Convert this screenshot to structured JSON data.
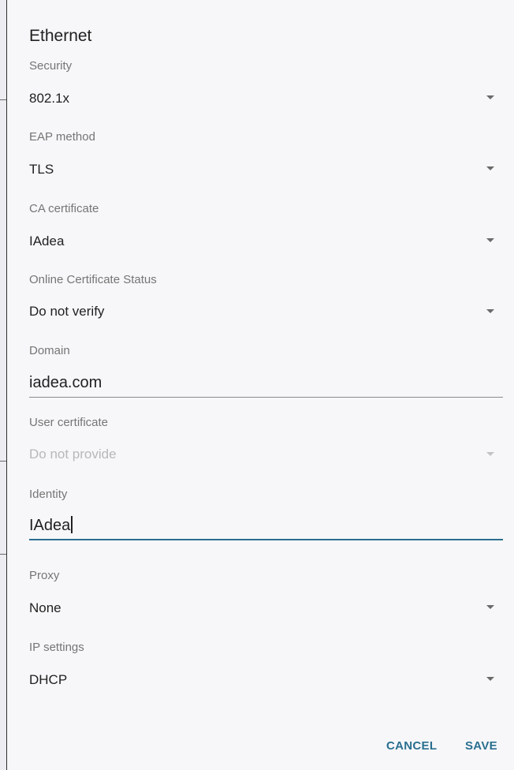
{
  "dialog": {
    "title": "Ethernet",
    "fields": {
      "security": {
        "label": "Security",
        "value": "802.1x"
      },
      "eap_method": {
        "label": "EAP method",
        "value": "TLS"
      },
      "ca_certificate": {
        "label": "CA certificate",
        "value": "IAdea"
      },
      "online_cert_status": {
        "label": "Online Certificate Status",
        "value": "Do not verify"
      },
      "domain": {
        "label": "Domain",
        "value": "iadea.com"
      },
      "user_certificate": {
        "label": "User certificate",
        "value": "Do not provide"
      },
      "identity": {
        "label": "Identity",
        "value": "IAdea"
      },
      "proxy": {
        "label": "Proxy",
        "value": "None"
      },
      "ip_settings": {
        "label": "IP settings",
        "value": "DHCP"
      }
    },
    "buttons": {
      "cancel": "CANCEL",
      "save": "SAVE"
    }
  },
  "colors": {
    "accent": "#2a6f8f",
    "background": "#f7f7fa",
    "label": "#757575",
    "text": "#212121",
    "disabled": "#b8b8b8"
  },
  "icons": {
    "dropdown": "dropdown-arrow-icon"
  }
}
